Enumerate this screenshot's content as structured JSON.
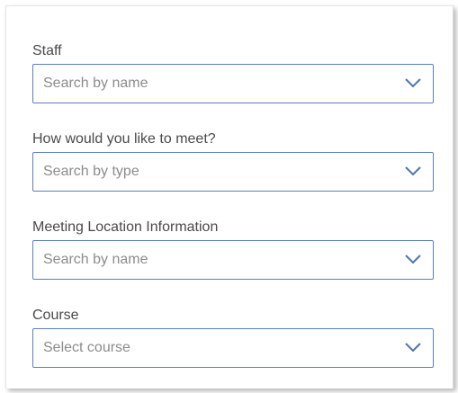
{
  "form": {
    "fields": [
      {
        "label": "Staff",
        "placeholder": "Search by name",
        "icon": "chevron-down-icon"
      },
      {
        "label": "How would you like to meet?",
        "placeholder": "Search by type",
        "icon": "chevron-down-icon"
      },
      {
        "label": "Meeting Location Information",
        "placeholder": "Search by name",
        "icon": "chevron-down-icon"
      },
      {
        "label": "Course",
        "placeholder": "Select course",
        "icon": "chevron-down-icon"
      }
    ]
  },
  "colors": {
    "border": "#5b7fbf",
    "label_text": "#4a4a4a",
    "placeholder_text": "#8c8c8c",
    "chevron": "#4f73b5"
  }
}
